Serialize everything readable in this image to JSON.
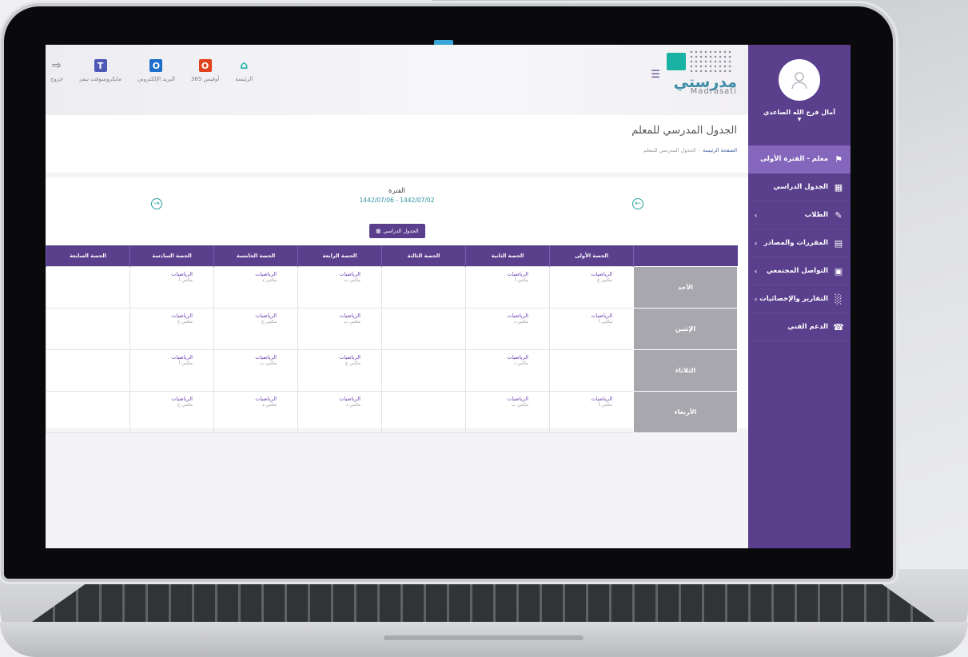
{
  "topbar": {
    "logo_ar": "مدرستي",
    "logo_en": "Madrasati",
    "links": [
      {
        "label": "الرئيسة",
        "icon": "home-icon",
        "color": "#1ab2a3"
      },
      {
        "label": "أوفيس 365",
        "icon": "office-icon",
        "color": "#e0431d"
      },
      {
        "label": "البريد الإلكتروني",
        "icon": "outlook-icon",
        "color": "#1e6fc9"
      },
      {
        "label": "مايكروسوفت تيمز",
        "icon": "teams-icon",
        "color": "#5058b8"
      },
      {
        "label": "خروج",
        "icon": "logout-icon",
        "color": "#8a8a92"
      }
    ]
  },
  "sidebar": {
    "user_name": "آمال فرج الله الصاعدي",
    "items": [
      {
        "label": "معلم - الفترة الأولى",
        "icon": "teacher-icon",
        "active": true,
        "arrow": false
      },
      {
        "label": "الجدول الدراسي",
        "icon": "calendar-icon",
        "active": false,
        "arrow": false
      },
      {
        "label": "الطلاب",
        "icon": "students-icon",
        "active": false,
        "arrow": true
      },
      {
        "label": "المقررات والمصادر",
        "icon": "courses-icon",
        "active": false,
        "arrow": true
      },
      {
        "label": "التواصل المجتمعي",
        "icon": "community-icon",
        "active": false,
        "arrow": true
      },
      {
        "label": "التقارير والإحصائيات",
        "icon": "reports-icon",
        "active": false,
        "arrow": true
      },
      {
        "label": "الدعم الفني",
        "icon": "support-icon",
        "active": false,
        "arrow": false
      }
    ]
  },
  "page": {
    "title": "الجدول المدرسي للمعلم",
    "breadcrumb_home": "الصفحة الرئيسة",
    "breadcrumb_current": "الجدول المدرسي للمعلم"
  },
  "period": {
    "label": "الفترة",
    "range": "1442/07/06 - 1442/07/02"
  },
  "schedule_button": "الجدول الدراسي",
  "table": {
    "headers": [
      "",
      "الحصة الأولى",
      "الحصة الثانية",
      "الحصة الثالثة",
      "الحصة الرابعة",
      "الحصة الخامسة",
      "الحصة السادسة",
      "الحصة السابعة"
    ],
    "rows": [
      {
        "day": "الأحد",
        "cells": [
          {
            "subject": "الرياضيات",
            "class": "مكتبي ج"
          },
          {
            "subject": "الرياضيات",
            "class": "مكتبي أ"
          },
          null,
          {
            "subject": "الرياضيات",
            "class": "مكتبي ب"
          },
          {
            "subject": "الرياضيات",
            "class": "مكتبي د"
          },
          {
            "subject": "الرياضيات",
            "class": "مكتبي أ"
          },
          null
        ]
      },
      {
        "day": "الإثنين",
        "cells": [
          {
            "subject": "الرياضيات",
            "class": "مكتبي أ"
          },
          {
            "subject": "الرياضيات",
            "class": "مكتبي د"
          },
          null,
          {
            "subject": "الرياضيات",
            "class": "مكتبي ب"
          },
          {
            "subject": "الرياضيات",
            "class": "مكتبي ج"
          },
          {
            "subject": "الرياضيات",
            "class": "مكتبي ج"
          },
          null
        ]
      },
      {
        "day": "الثلاثاء",
        "cells": [
          null,
          {
            "subject": "الرياضيات",
            "class": "مكتبي د"
          },
          null,
          {
            "subject": "الرياضيات",
            "class": "مكتبي ج"
          },
          {
            "subject": "الرياضيات",
            "class": "مكتبي ب"
          },
          {
            "subject": "الرياضيات",
            "class": "مكتبي أ"
          },
          null
        ]
      },
      {
        "day": "الأربعاء",
        "cells": [
          {
            "subject": "الرياضيات",
            "class": "مكتبي أ"
          },
          {
            "subject": "الرياضيات",
            "class": "مكتبي ب"
          },
          null,
          {
            "subject": "الرياضيات",
            "class": "مكتبي د"
          },
          {
            "subject": "الرياضيات",
            "class": "مكتبي د"
          },
          {
            "subject": "الرياضيات",
            "class": "مكتبي ج"
          },
          null
        ]
      }
    ]
  },
  "colors": {
    "sidebar": "#5a3f8d",
    "sidebar_active": "#8466bd",
    "accent": "#2a8ea0",
    "subject_text": "#6a3fb0"
  }
}
